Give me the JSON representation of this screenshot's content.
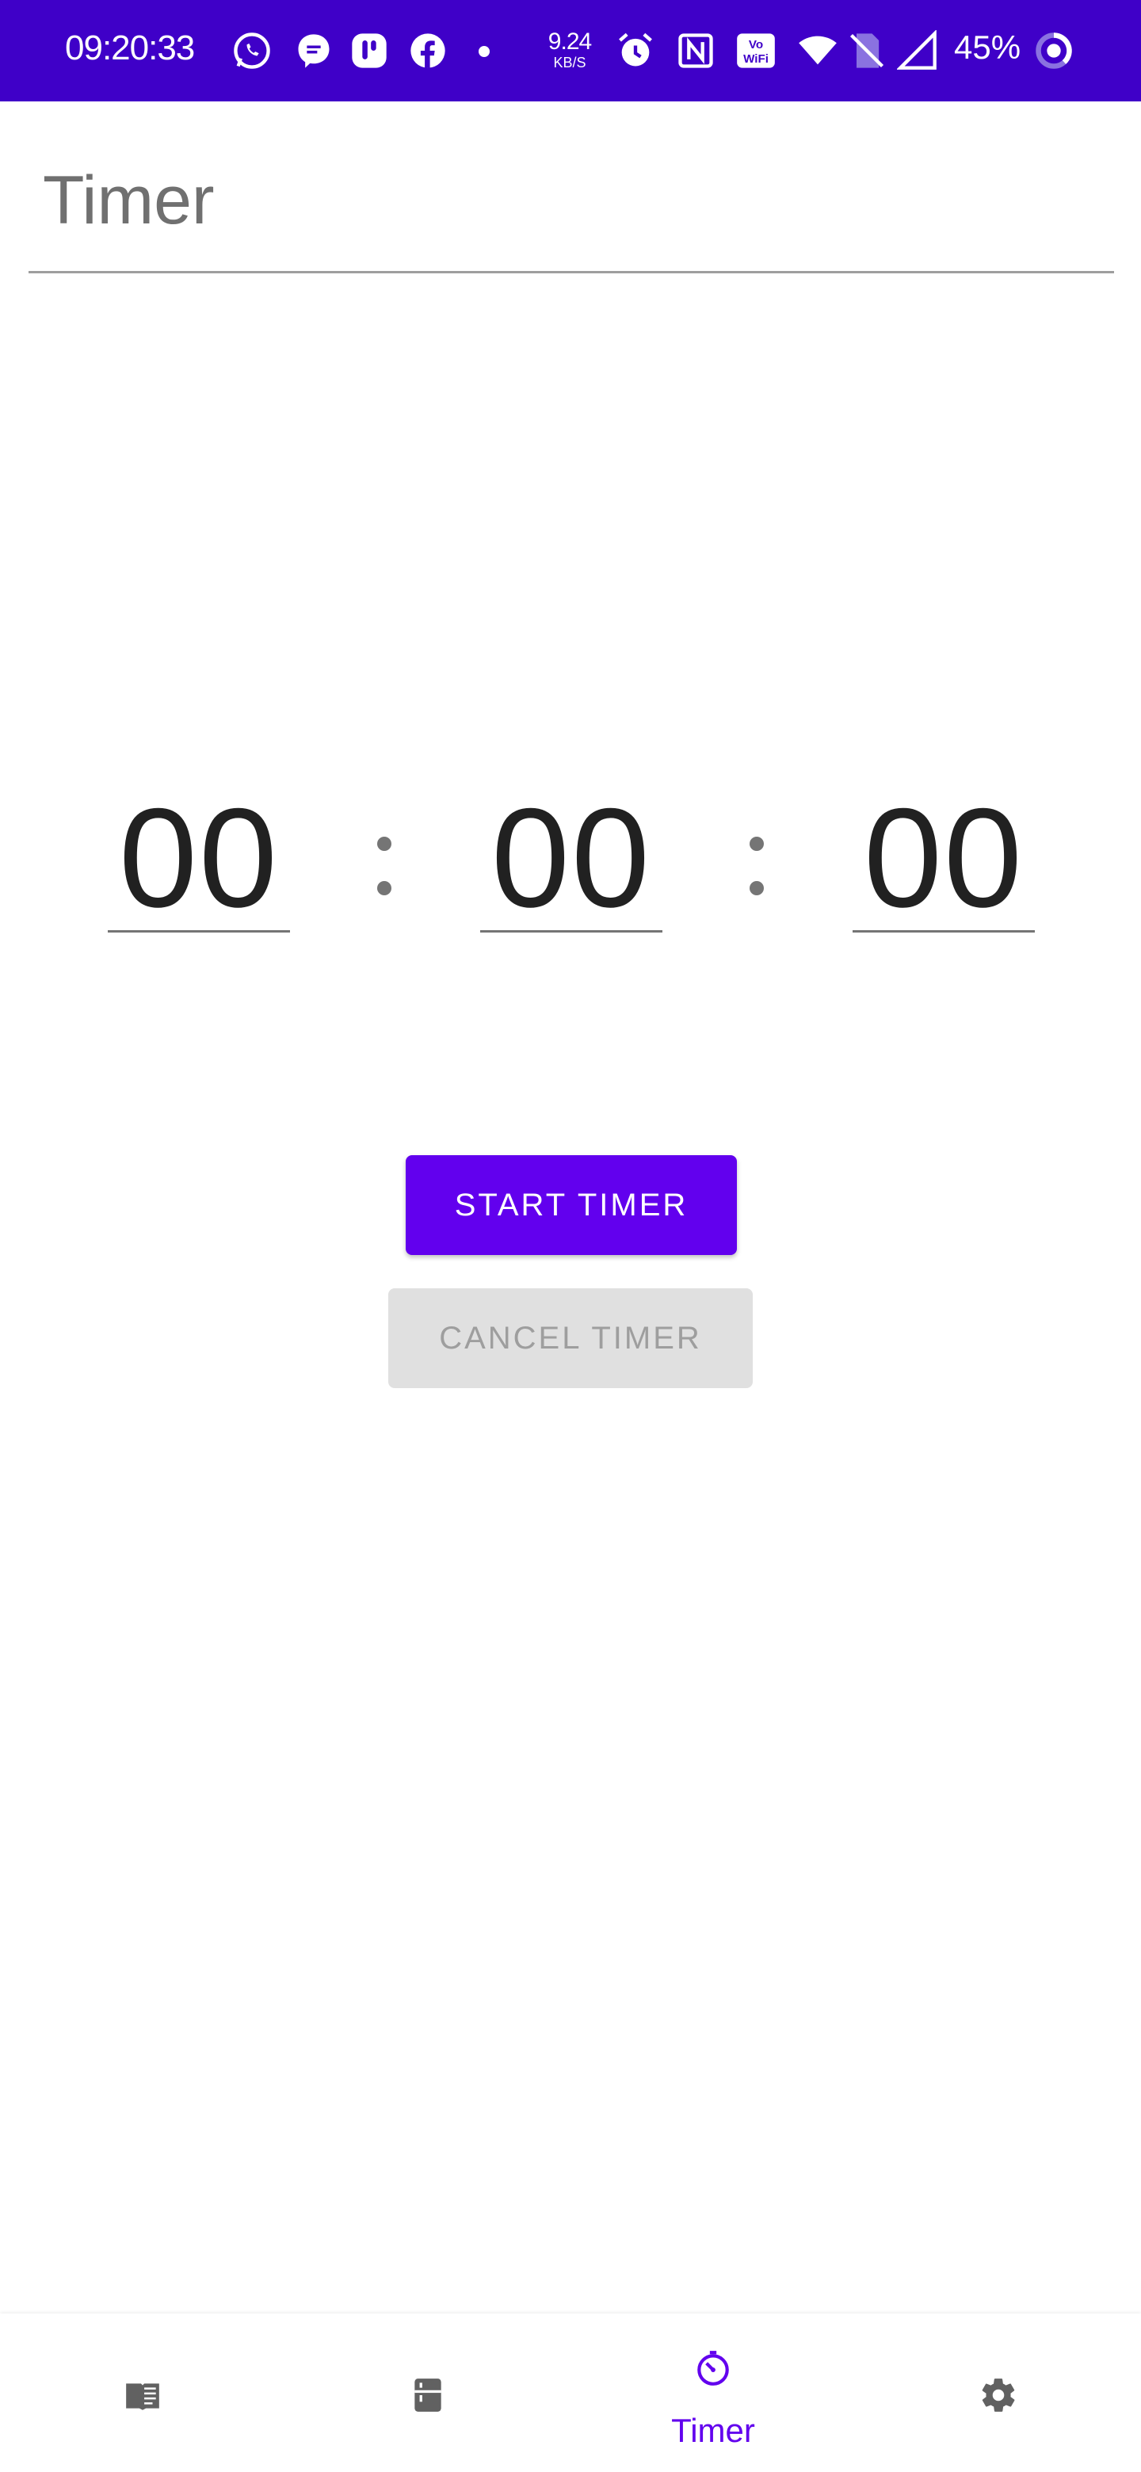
{
  "status_bar": {
    "time": "09:20:33",
    "net_speed_value": "9.24",
    "net_speed_unit": "KB/S",
    "battery": "45%",
    "icons": [
      "whatsapp-icon",
      "messages-icon",
      "app-t-icon",
      "facebook-icon",
      "dot-icon",
      "alarm-icon",
      "nfc-icon",
      "vowifi-icon",
      "wifi-icon",
      "no-sim-icon",
      "signal-icon",
      "battery-ring-icon"
    ]
  },
  "header": {
    "title": "Timer"
  },
  "timer": {
    "hours": "00",
    "minutes": "00",
    "seconds": "00"
  },
  "buttons": {
    "start": "START TIMER",
    "cancel": "CANCEL TIMER"
  },
  "bottom_nav": {
    "items": [
      {
        "icon": "book-icon",
        "label": ""
      },
      {
        "icon": "kitchen-icon",
        "label": ""
      },
      {
        "icon": "timer-icon",
        "label": "Timer",
        "active": true
      },
      {
        "icon": "settings-icon",
        "label": ""
      }
    ]
  },
  "colors": {
    "status_bar": "#3f00c8",
    "accent": "#6200ee",
    "disabled_button": "#e0e0e0"
  }
}
